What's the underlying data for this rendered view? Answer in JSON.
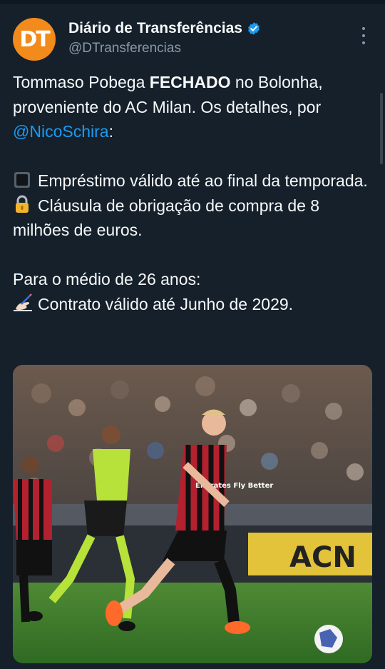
{
  "author": {
    "avatar_text": "DT",
    "name": "Diário de Transferências",
    "handle": "@DTransferencias",
    "verified": true
  },
  "tweet": {
    "line1_pre": "Tommaso Pobega ",
    "line1_bold": "FECHADO",
    "line1_post": " no Bolonha, proveniente do AC Milan. Os detalhes, por ",
    "mention": "@NicoSchira",
    "line1_end": ":",
    "bullet1_icon": "black-square-icon",
    "bullet1": "Empréstimo válido até ao final da temporada.",
    "bullet2_icon": "lock-icon",
    "bullet2": "Cláusula de obrigação de compra de 8 milhões de euros.",
    "para3": "Para o médio de 26 anos:",
    "bullet3_icon": "writing-hand-icon",
    "bullet3": "Contrato válido até Junho de 2029."
  },
  "photo": {
    "jersey_text": "Emirates Fly Better",
    "board_text": "ACN"
  },
  "colors": {
    "background": "#15202b",
    "text": "#f7f9f9",
    "secondary": "#8b98a5",
    "link": "#1d9bf0",
    "avatar": "#f28b1c"
  }
}
